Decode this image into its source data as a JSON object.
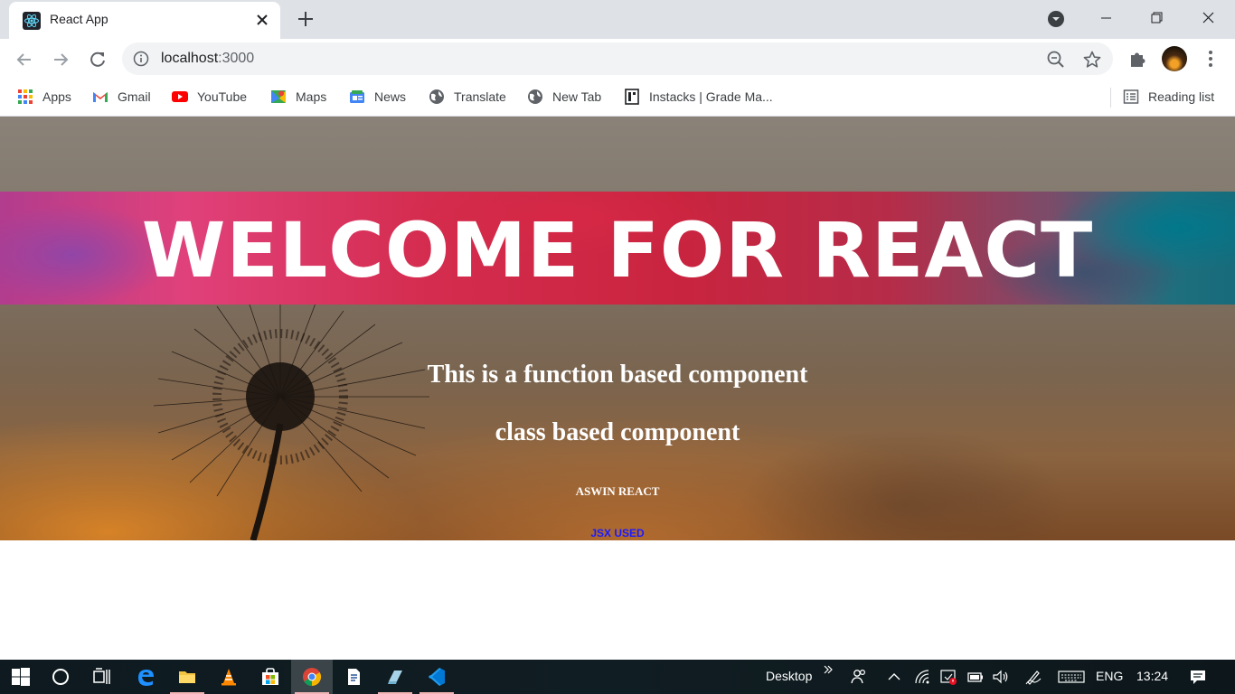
{
  "browser": {
    "tab": {
      "title": "React App"
    },
    "omnibox": {
      "host": "localhost",
      "port": ":3000"
    },
    "bookmarks": [
      {
        "label": "Apps",
        "icon": "apps-grid-icon"
      },
      {
        "label": "Gmail",
        "icon": "gmail-icon"
      },
      {
        "label": "YouTube",
        "icon": "youtube-icon"
      },
      {
        "label": "Maps",
        "icon": "maps-icon"
      },
      {
        "label": "News",
        "icon": "news-icon"
      },
      {
        "label": "Translate",
        "icon": "globe-icon"
      },
      {
        "label": "New Tab",
        "icon": "globe-icon"
      },
      {
        "label": "Instacks | Grade Ma...",
        "icon": "instacks-icon"
      }
    ],
    "reading_list": {
      "label": "Reading list"
    }
  },
  "page": {
    "banner_title": "WELCOME FOR REACT",
    "function_heading": "This is a function based component",
    "class_heading": "class based component",
    "author_heading": "ASWIN REACT",
    "jsx_text": "JSX USED"
  },
  "taskbar": {
    "desktop_label": "Desktop",
    "language": "ENG",
    "time": "13:24"
  },
  "colors": {
    "tabstrip_bg": "#dee1e6",
    "omnibox_bg": "#f1f3f4",
    "jsx_link": "#1a1aff",
    "taskbar_bg": "#101d22"
  }
}
